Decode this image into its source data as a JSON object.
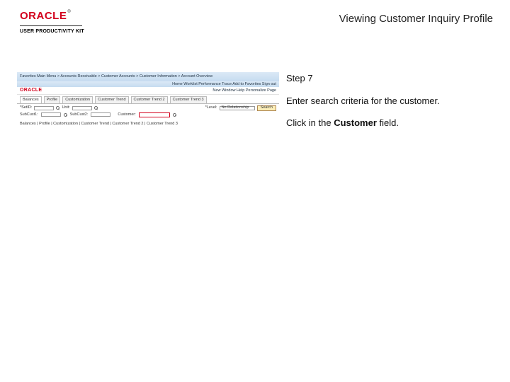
{
  "header": {
    "brand": "ORACLE",
    "subbrand": "USER PRODUCTIVITY KIT",
    "title": "Viewing Customer Inquiry Profile"
  },
  "instruction": {
    "step_label": "Step 7",
    "line1": "Enter search criteria for the customer.",
    "line2_prefix": "Click in the ",
    "line2_bold": "Customer",
    "line2_suffix": " field."
  },
  "mini": {
    "bluebar": {
      "crumbs": "Favorites   Main Menu > Accounts Receivable > Customer Accounts > Customer Information > Account Overview",
      "right": "Home   Worklist   Performance Trace   Add to Favorites   Sign out"
    },
    "redbar": {
      "brand": "ORACLE",
      "rlinks": "New Window  Help  Personalize Page"
    },
    "tabs": [
      "Balances",
      "Profile",
      "Customization",
      "Customer Trend",
      "Customer Trend 2",
      "Customer Trend 3"
    ],
    "form": {
      "setid_lbl": "*SetID:",
      "setid_val": "",
      "unit_lbl": "Unit:",
      "unit_val": "",
      "level_lbl": "*Level:",
      "level_val": "No Relationship",
      "search_btn": "Search",
      "sub_lbl": "SubCust1:",
      "sub2_lbl": "SubCust2:",
      "cust_lbl": "Customer:"
    },
    "status": "Balances | Profile | Customization | Customer Trend | Customer Trend 2 | Customer Trend 3"
  }
}
